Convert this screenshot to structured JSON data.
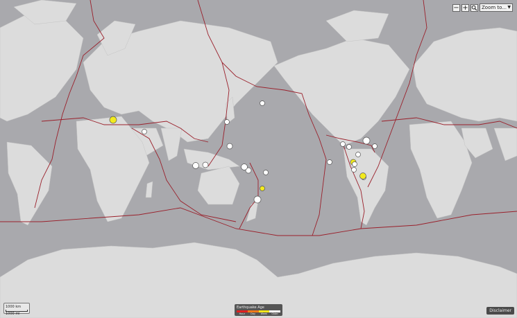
{
  "controls": {
    "zoom_out": "−",
    "zoom_in": "+",
    "search_icon": "magnifier-icon",
    "zoom_select": "Zoom to...",
    "zoom_arrow": "▼"
  },
  "scale": {
    "top": "1000 km",
    "bottom": "1000 mi"
  },
  "legend": {
    "title": "Earthquake Age",
    "labels": [
      "Hour",
      "Day",
      "Week",
      "Older"
    ],
    "colors": [
      "#e02020",
      "#f07a1a",
      "#f5e61a",
      "#ffffff"
    ]
  },
  "disclaimer": "Disclaimer",
  "colors": {
    "ocean": "#a9a9ad",
    "land": "#dcdcdc",
    "plate_boundary": "#9a1f2a",
    "quake_week": "#f2ea1e",
    "quake_older": "#ffffff"
  },
  "earthquakes": [
    {
      "age": "week"
    },
    {
      "age": "older"
    },
    {
      "age": "older"
    },
    {
      "age": "older"
    },
    {
      "age": "older"
    },
    {
      "age": "older"
    },
    {
      "age": "older"
    },
    {
      "age": "older"
    },
    {
      "age": "older"
    },
    {
      "age": "week"
    },
    {
      "age": "older"
    },
    {
      "age": "older"
    },
    {
      "age": "older"
    },
    {
      "age": "older"
    },
    {
      "age": "older"
    },
    {
      "age": "older"
    },
    {
      "age": "older"
    },
    {
      "age": "older"
    },
    {
      "age": "older"
    },
    {
      "age": "older"
    },
    {
      "age": "week"
    },
    {
      "age": "older"
    },
    {
      "age": "week"
    }
  ]
}
